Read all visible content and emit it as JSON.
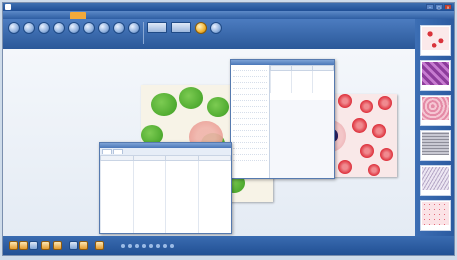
{
  "window": {
    "title": ""
  },
  "menu": {
    "items": [
      "",
      "",
      "",
      "",
      "",
      "",
      ""
    ],
    "active_index": 4
  },
  "colors": {
    "accent": "#f1a93b",
    "chrome": "#2e5ea3",
    "rbc": "#e0343e",
    "stain_green": "#4caf2a"
  },
  "toolbar": {
    "tools": [
      "",
      "",
      "",
      "",
      "",
      "",
      "",
      "",
      ""
    ],
    "group_tools": [
      "",
      ""
    ],
    "extra_tools": [
      "",
      ""
    ]
  },
  "side_panel": {
    "thumbnails": [
      {
        "name": "thumb-1",
        "caption": "",
        "style": "sparse-red"
      },
      {
        "name": "thumb-2",
        "caption": "",
        "style": "purple-tissue"
      },
      {
        "name": "thumb-3",
        "caption": "",
        "style": "pink-tissue"
      },
      {
        "name": "thumb-4",
        "caption": "",
        "style": "gray-texture"
      },
      {
        "name": "thumb-5",
        "caption": "",
        "style": "light-texture"
      },
      {
        "name": "thumb-6",
        "caption": "",
        "style": "pink-dots"
      }
    ]
  },
  "data_dialog": {
    "tabs": [
      "",
      ""
    ],
    "columns": [
      "",
      "",
      "",
      ""
    ],
    "row_count": 24
  },
  "info_panel": {
    "columns": [
      "",
      "",
      ""
    ],
    "row_count": 6,
    "list_items": 16
  },
  "statusbar": {
    "buttons": [
      "",
      "",
      "",
      "",
      "",
      "",
      "",
      ""
    ]
  }
}
